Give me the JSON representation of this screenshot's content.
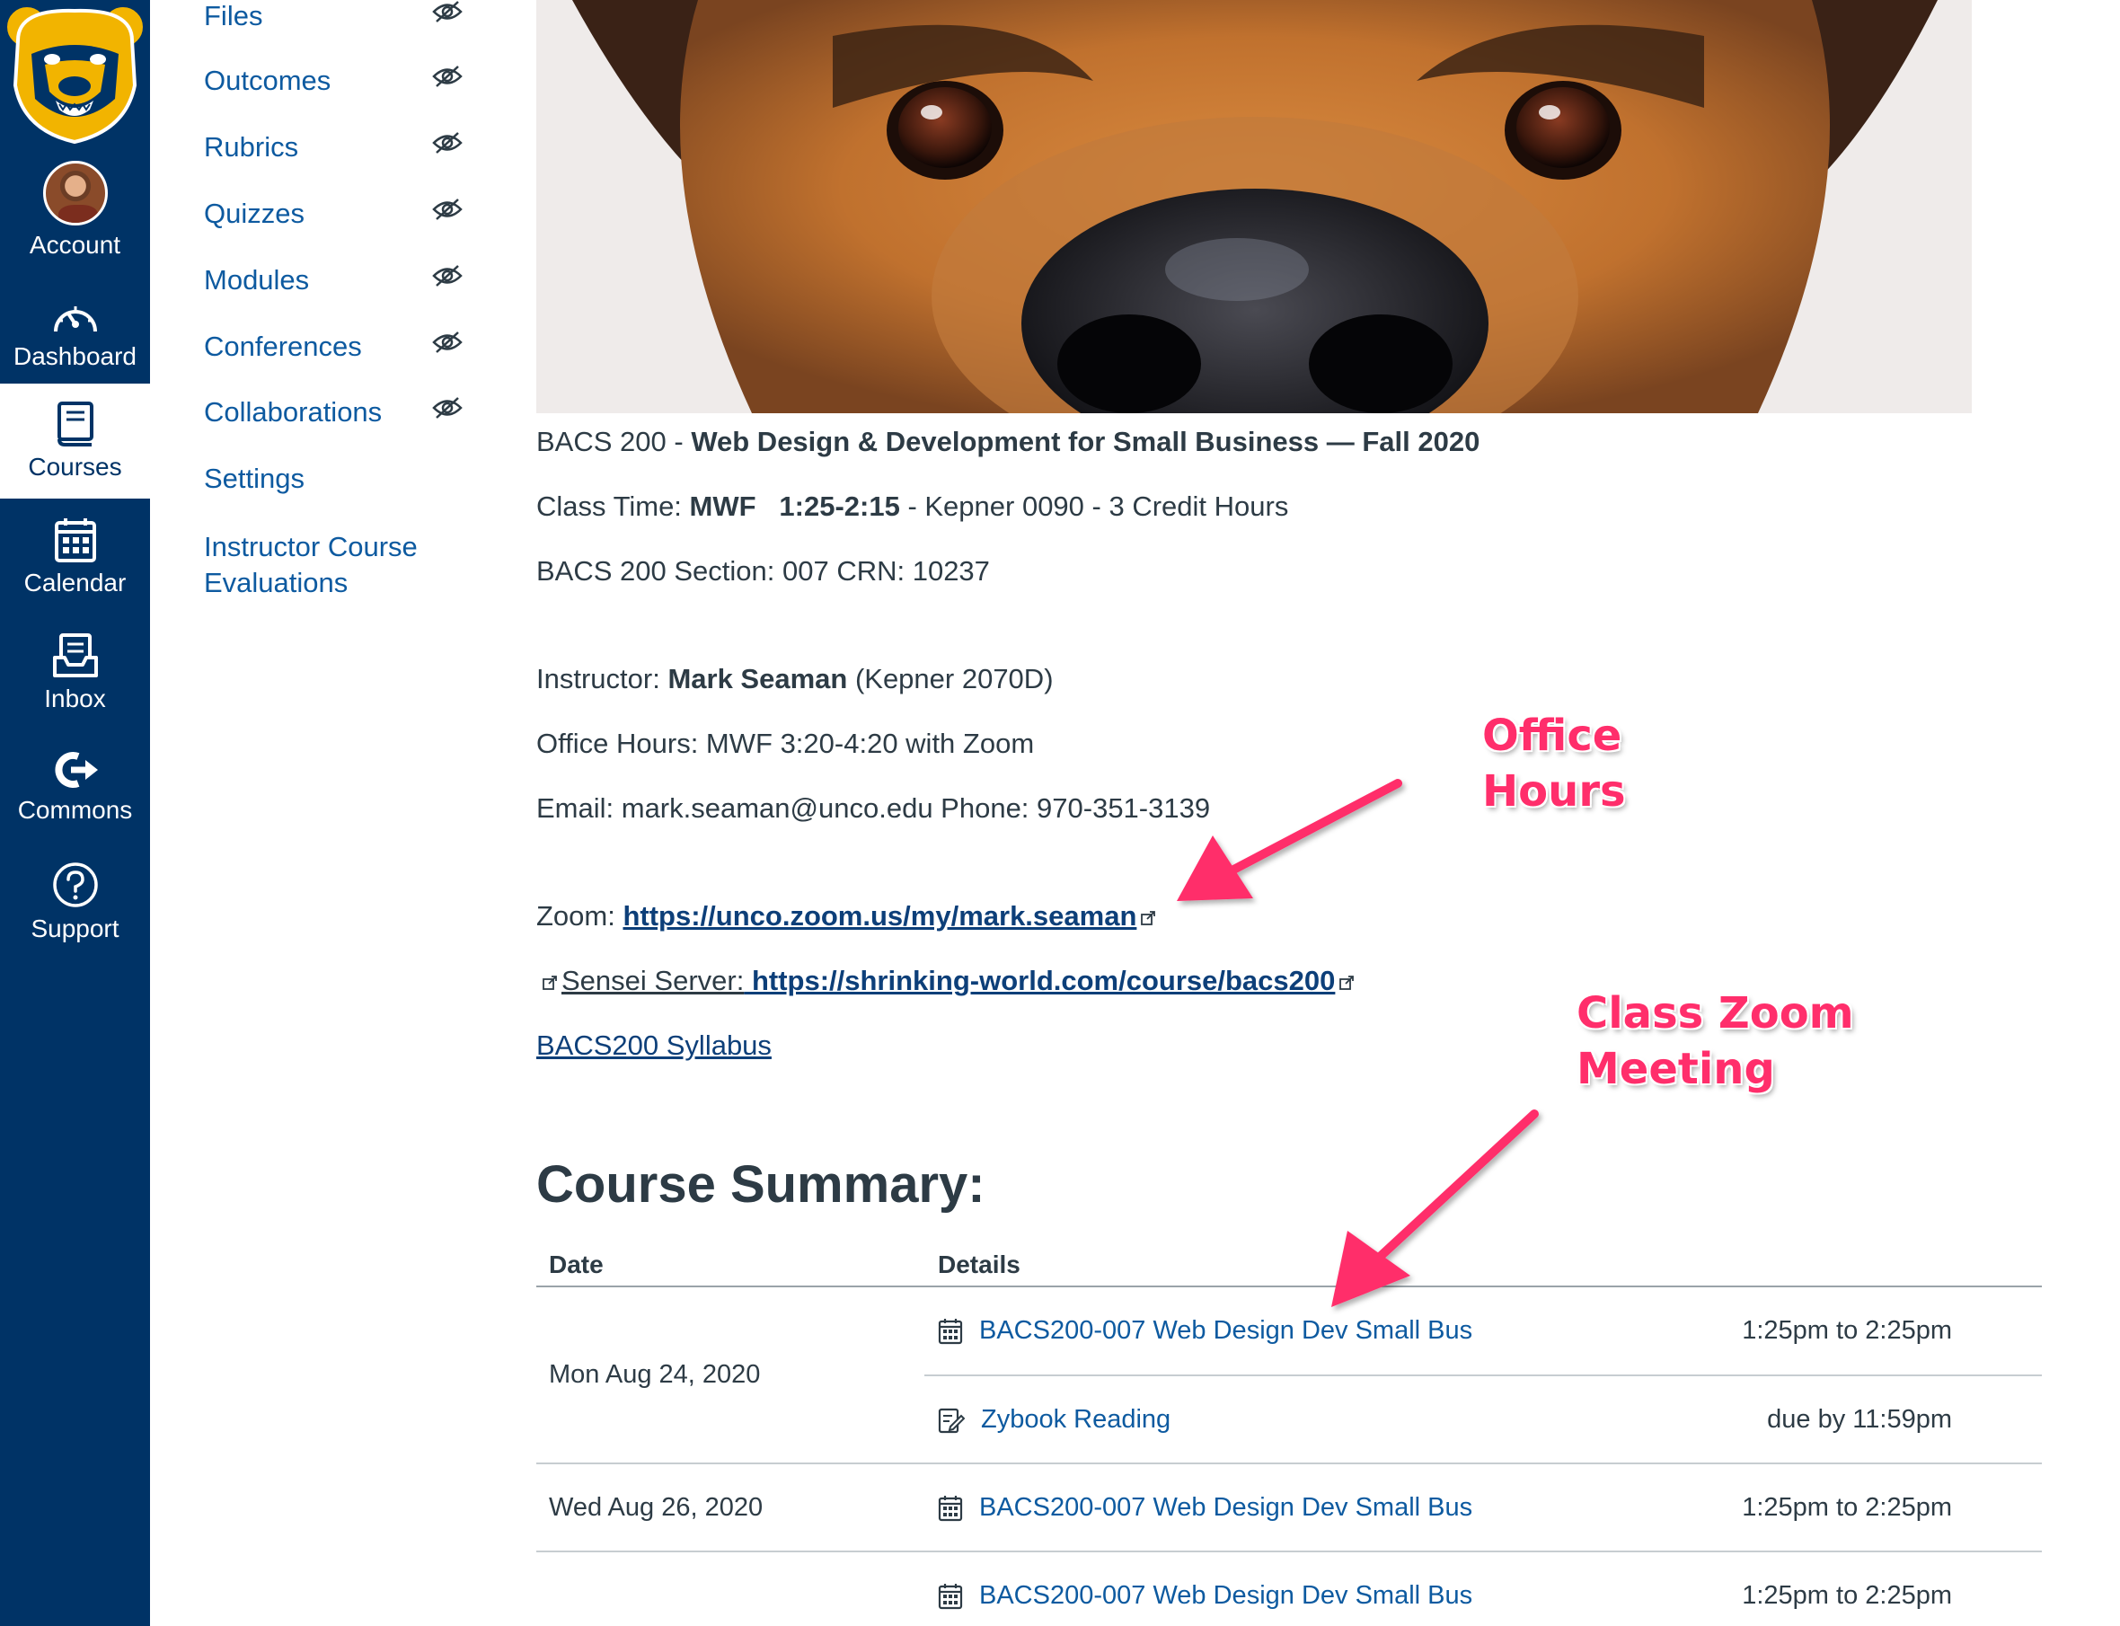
{
  "global_nav": {
    "items": [
      {
        "label": "Account",
        "icon": "avatar"
      },
      {
        "label": "Dashboard",
        "icon": "dashboard-icon"
      },
      {
        "label": "Courses",
        "icon": "courses-icon",
        "active": true
      },
      {
        "label": "Calendar",
        "icon": "calendar-icon"
      },
      {
        "label": "Inbox",
        "icon": "inbox-icon"
      },
      {
        "label": "Commons",
        "icon": "commons-icon"
      },
      {
        "label": "Support",
        "icon": "support-icon"
      }
    ]
  },
  "course_nav": {
    "items": [
      {
        "label": "Files",
        "hidden_icon": true
      },
      {
        "label": "Outcomes",
        "hidden_icon": true
      },
      {
        "label": "Rubrics",
        "hidden_icon": true
      },
      {
        "label": "Quizzes",
        "hidden_icon": true
      },
      {
        "label": "Modules",
        "hidden_icon": true
      },
      {
        "label": "Conferences",
        "hidden_icon": true
      },
      {
        "label": "Collaborations",
        "hidden_icon": true
      },
      {
        "label": "Settings",
        "hidden_icon": false
      },
      {
        "label": "Instructor Course",
        "label2": "Evaluations",
        "hidden_icon": false
      }
    ]
  },
  "course_info": {
    "title_prefix": "BACS 200 - ",
    "title_bold": "Web Design & Development for Small Business — Fall 2020",
    "class_time_label": "Class Time: ",
    "class_time_days": "MWF",
    "class_time_hours": "1:25-2:15",
    "class_time_rest": " - Kepner 0090 - 3 Credit Hours",
    "section": "BACS 200 Section: 007 CRN: 10237",
    "instructor_label": "Instructor: ",
    "instructor_name": "Mark Seaman",
    "instructor_office": " (Kepner 2070D)",
    "office_hours": "Office Hours: MWF  3:20-4:20 with Zoom",
    "contact": "Email: mark.seaman@unco.edu Phone: 970-351-3139",
    "zoom_label": "Zoom: ",
    "zoom_link": "https://unco.zoom.us/my/mark.seaman",
    "sensei_label": "Sensei Server:",
    "sensei_link": " https://shrinking-world.com/course/bacs200",
    "syllabus_link": "BACS200 Syllabus"
  },
  "summary": {
    "title": "Course Summary:",
    "col_date": "Date",
    "col_details": "Details",
    "rows": [
      {
        "date": "Mon Aug 24, 2020",
        "events": [
          {
            "icon": "calendar-event-icon",
            "title": "BACS200-007 Web Design Dev Small Bus",
            "time": "1:25pm to 2:25pm"
          },
          {
            "icon": "assignment-icon",
            "title": "Zybook Reading",
            "time": "due by 11:59pm"
          }
        ]
      },
      {
        "date": "Wed Aug 26, 2020",
        "events": [
          {
            "icon": "calendar-event-icon",
            "title": "BACS200-007 Web Design Dev Small Bus",
            "time": "1:25pm to 2:25pm"
          }
        ]
      },
      {
        "date": "",
        "events": [
          {
            "icon": "calendar-event-icon",
            "title": "BACS200-007 Web Design Dev Small Bus",
            "time": "1:25pm to 2:25pm"
          }
        ]
      }
    ]
  },
  "annotations": {
    "office_hours": [
      "Office",
      "Hours"
    ],
    "class_zoom": [
      "Class Zoom",
      "Meeting"
    ],
    "color": "#ff2e6b"
  },
  "colors": {
    "nav_bg": "#003366",
    "link": "#0d5aa0",
    "text": "#2d3b45"
  }
}
